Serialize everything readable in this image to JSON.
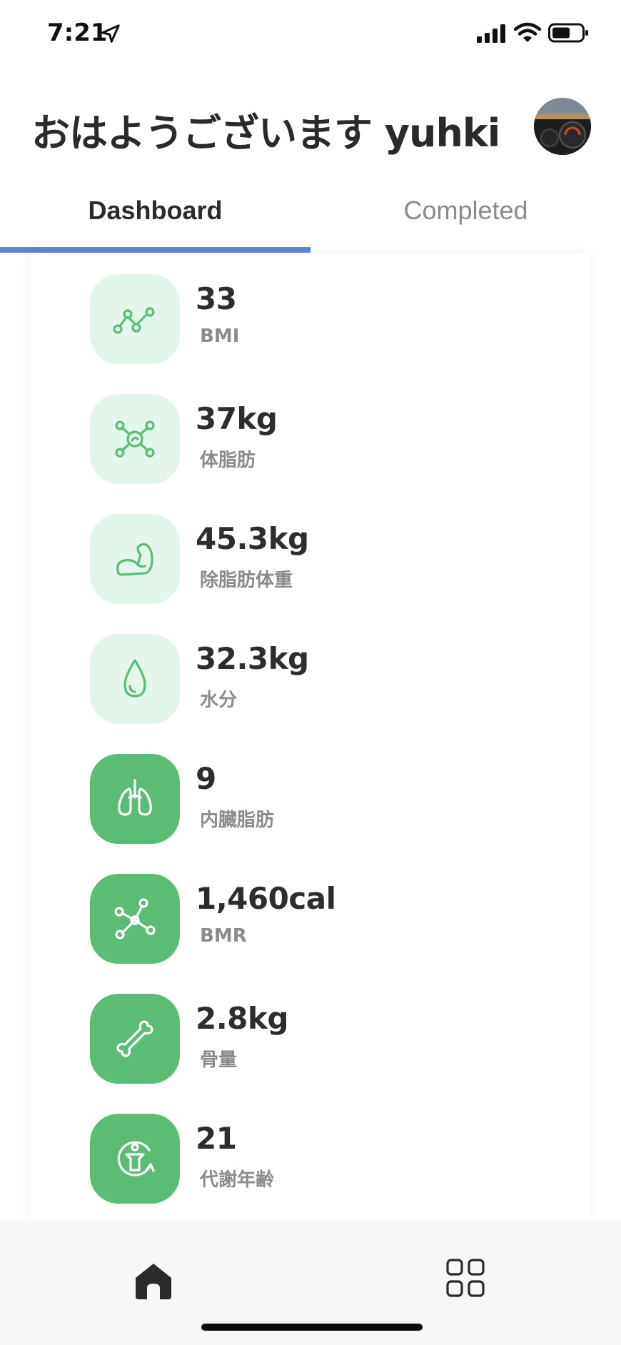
{
  "status_bar": {
    "time": "7:21"
  },
  "header": {
    "greeting": "おはようございます yuhki"
  },
  "tabs": [
    {
      "label": "Dashboard",
      "active": true
    },
    {
      "label": "Completed",
      "active": false
    }
  ],
  "colors": {
    "accent_blue": "#5c86d6",
    "green": "#5bbd74",
    "green_light": "#e3f6ec"
  },
  "metrics": [
    {
      "value": "33",
      "label": "BMI",
      "icon": "line-chart-icon",
      "style": "light"
    },
    {
      "value": "37kg",
      "label": "体脂肪",
      "icon": "molecule-icon",
      "style": "light"
    },
    {
      "value": "45.3kg",
      "label": "除脂肪体重",
      "icon": "flexed-arm-icon",
      "style": "light"
    },
    {
      "value": "32.3kg",
      "label": "水分",
      "icon": "water-drop-icon",
      "style": "light"
    },
    {
      "value": "9",
      "label": "内臓脂肪",
      "icon": "lungs-icon",
      "style": "dark"
    },
    {
      "value": "1,460cal",
      "label": "BMR",
      "icon": "network-icon",
      "style": "dark"
    },
    {
      "value": "2.8kg",
      "label": "骨量",
      "icon": "bone-icon",
      "style": "dark"
    },
    {
      "value": "21",
      "label": "代謝年齢",
      "icon": "metabolic-age-icon",
      "style": "dark"
    }
  ],
  "bottom_nav": [
    {
      "icon": "home-icon",
      "active": true
    },
    {
      "icon": "grid-icon",
      "active": false
    }
  ]
}
